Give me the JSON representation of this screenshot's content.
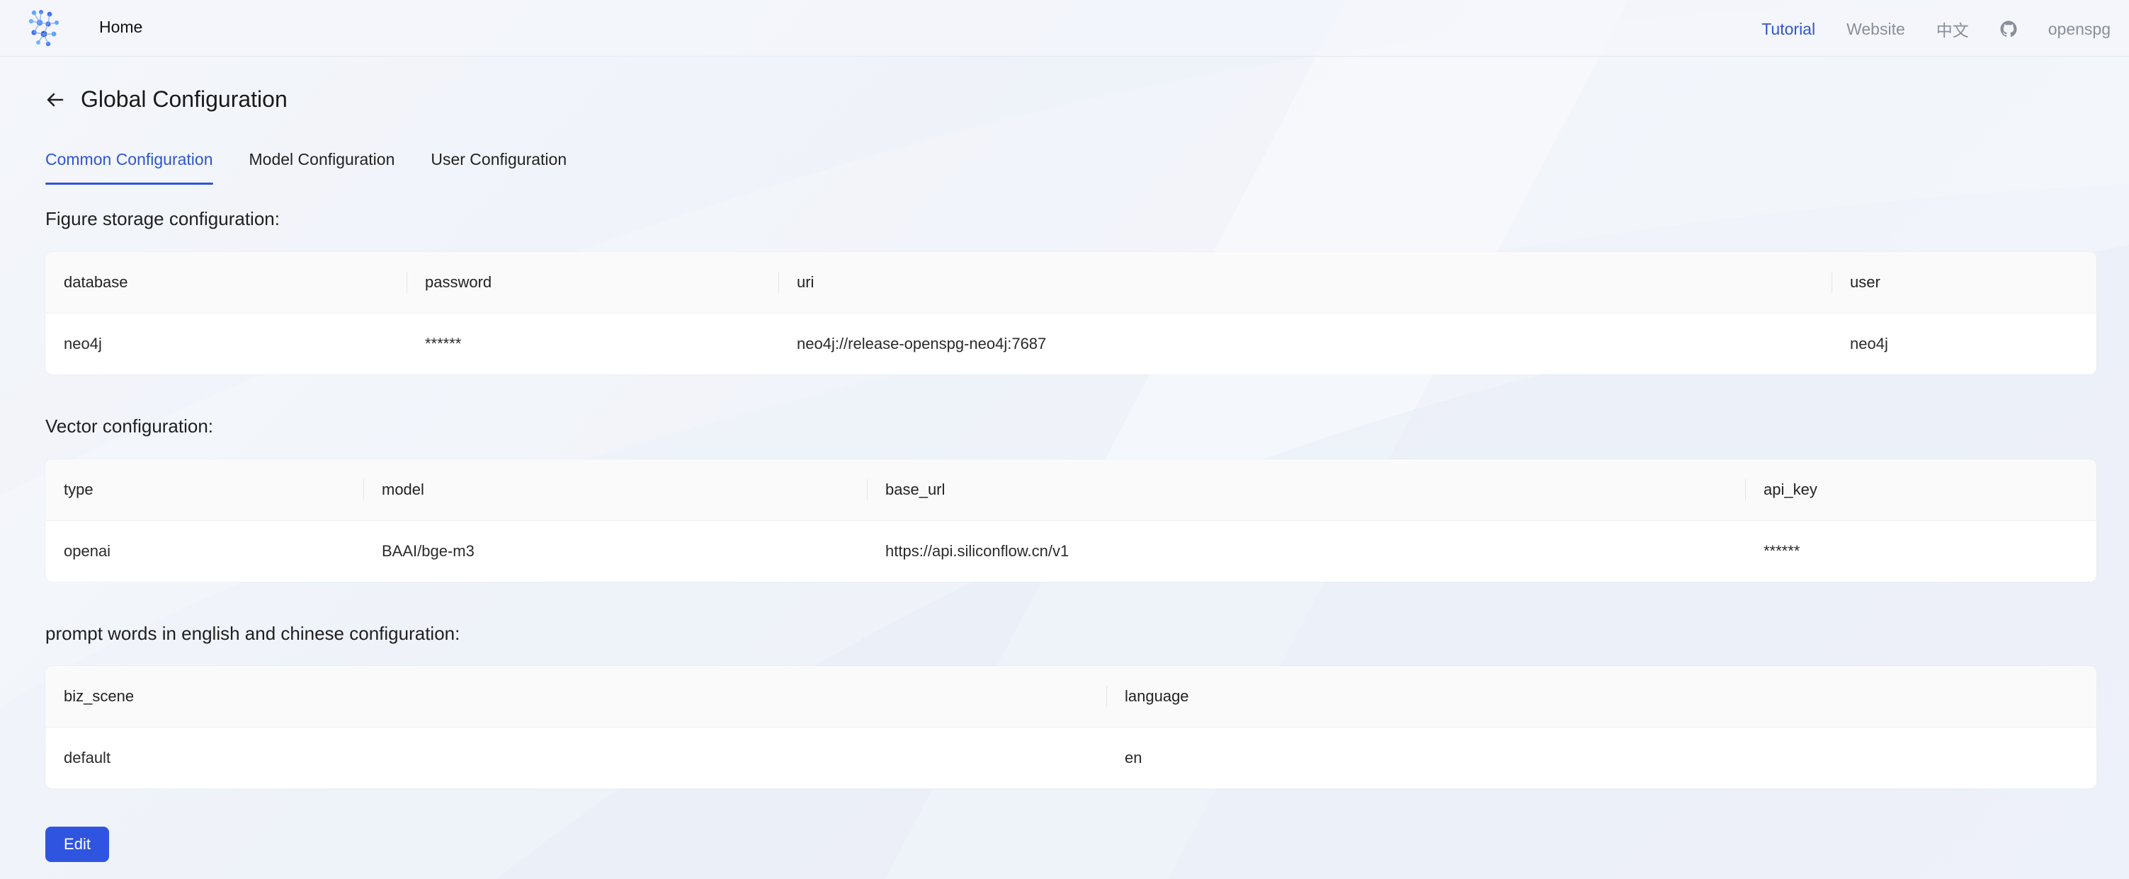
{
  "header": {
    "home_label": "Home",
    "links": {
      "tutorial": "Tutorial",
      "website": "Website",
      "language": "中文",
      "user": "openspg"
    },
    "accent_color": "#2f55d4"
  },
  "page": {
    "title": "Global Configuration",
    "tabs": [
      "Common Configuration",
      "Model Configuration",
      "User Configuration"
    ],
    "active_tab": "Common Configuration"
  },
  "sections": {
    "figure_storage": {
      "title": "Figure storage configuration:",
      "columns": [
        "database",
        "password",
        "uri",
        "user"
      ],
      "rows": [
        [
          "neo4j",
          "******",
          "neo4j://release-openspg-neo4j:7687",
          "neo4j"
        ]
      ]
    },
    "vector": {
      "title": "Vector configuration:",
      "columns": [
        "type",
        "model",
        "base_url",
        "api_key"
      ],
      "rows": [
        [
          "openai",
          "BAAI/bge-m3",
          "https://api.siliconflow.cn/v1",
          "******"
        ]
      ]
    },
    "prompt": {
      "title": "prompt words in english and chinese configuration:",
      "columns": [
        "biz_scene",
        "language"
      ],
      "rows": [
        [
          "default",
          "en"
        ]
      ]
    }
  },
  "actions": {
    "edit_label": "Edit"
  },
  "icons": {
    "logo": "openspg-logo-icon",
    "back": "arrow-left-icon",
    "github": "github-icon"
  }
}
